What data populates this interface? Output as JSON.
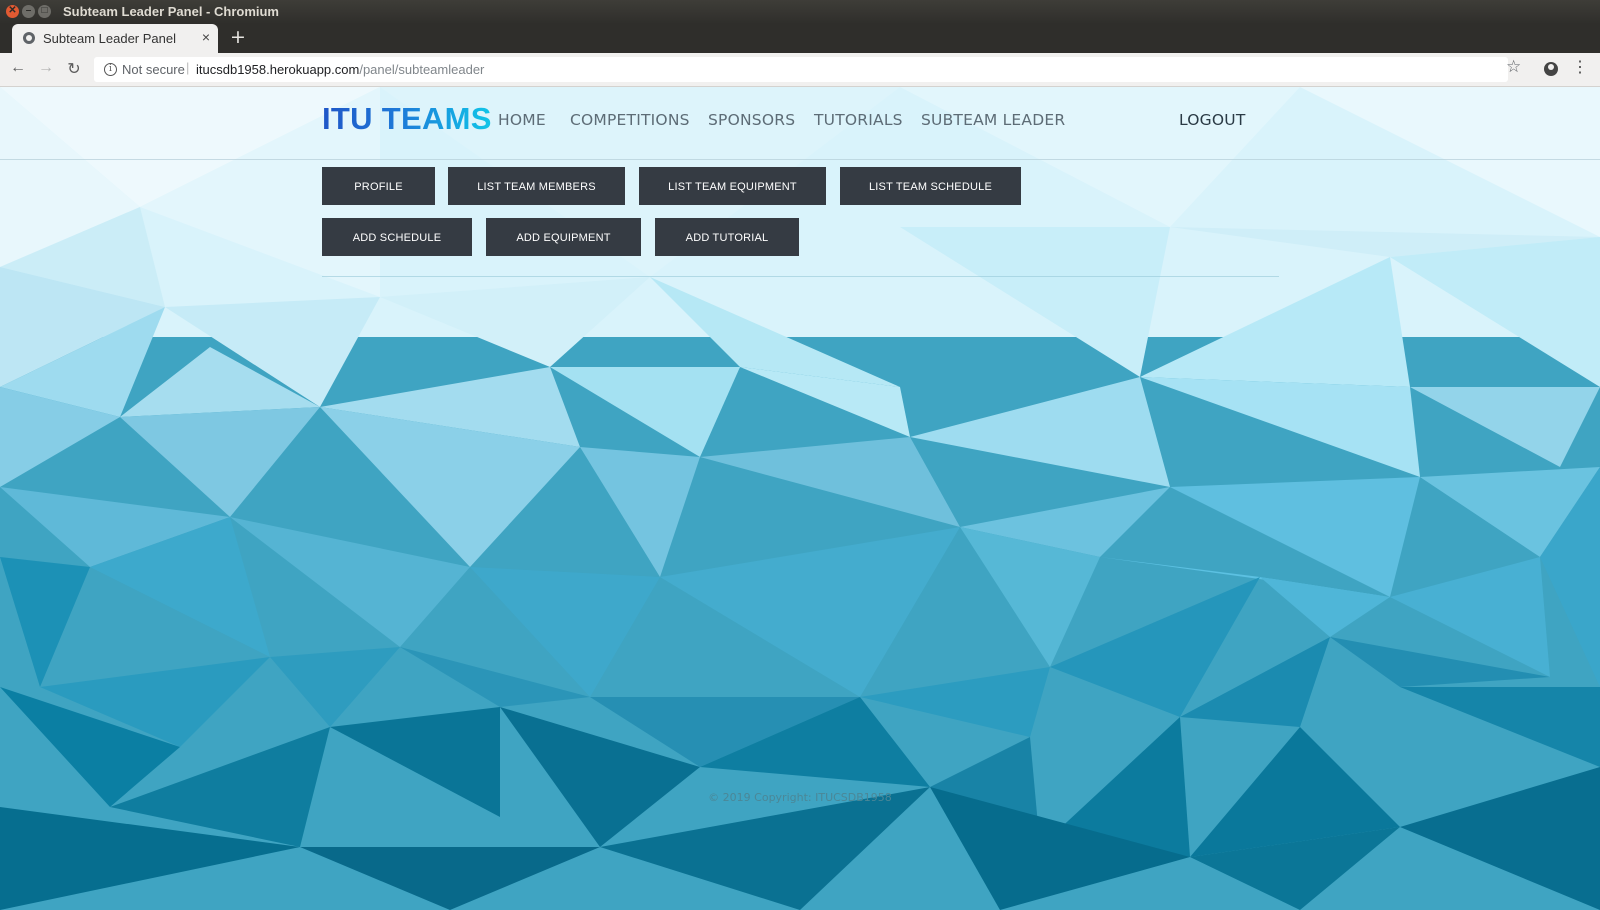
{
  "os": {
    "window_title": "Subteam Leader Panel - Chromium"
  },
  "browser": {
    "tab_title": "Subteam Leader Panel",
    "tab_close": "×",
    "new_tab": "+",
    "security_label": "Not secure",
    "url_host": "itucsdb1958.herokuapp.com",
    "url_path": "/panel/subteamleader"
  },
  "navbar": {
    "brand": "ITU TEAMS",
    "links": [
      "HOME",
      "COMPETITIONS",
      "SPONSORS",
      "TUTORIALS",
      "SUBTEAM LEADER"
    ],
    "logout": "LOGOUT"
  },
  "panel": {
    "row1": [
      "PROFILE",
      "LIST TEAM MEMBERS",
      "LIST TEAM EQUIPMENT",
      "LIST TEAM SCHEDULE"
    ],
    "row2": [
      "ADD SCHEDULE",
      "ADD EQUIPMENT",
      "ADD TUTORIAL"
    ]
  },
  "footer": {
    "copyright": "© 2019 Copyright: ITUCSDB1958"
  },
  "colors": {
    "button_bg": "#353b43",
    "brand_start": "#1f56c7",
    "brand_end": "#11c6e8"
  }
}
